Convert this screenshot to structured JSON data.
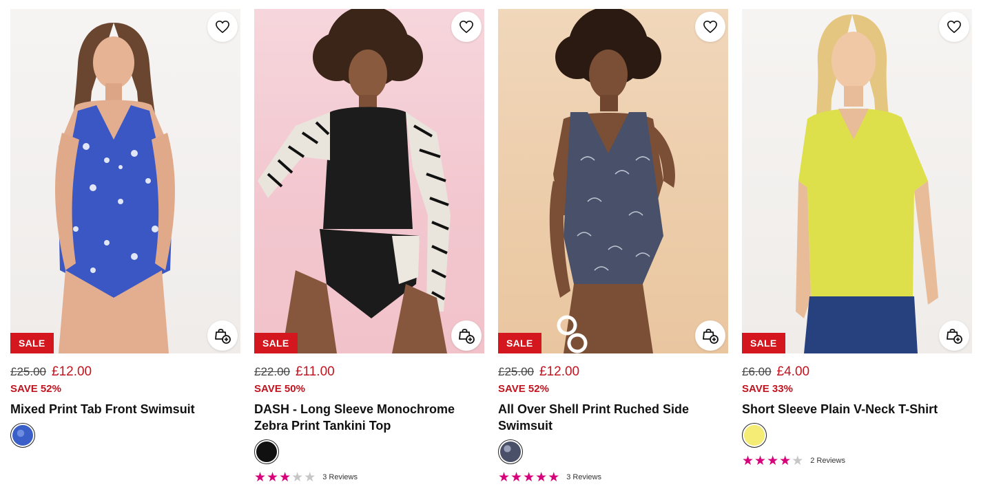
{
  "products": [
    {
      "badge": "SALE",
      "was_price": "£25.00",
      "now_price": "£12.00",
      "save": "SAVE 52%",
      "title": "Mixed Print Tab Front Swimsuit",
      "swatch_color": "#3a5fc8",
      "reviews": null,
      "stars": 0
    },
    {
      "badge": "SALE",
      "was_price": "£22.00",
      "now_price": "£11.00",
      "save": "SAVE 50%",
      "title": "DASH - Long Sleeve Monochrome Zebra Print Tankini Top",
      "swatch_color": "#111111",
      "reviews": "3 Reviews",
      "stars": 3
    },
    {
      "badge": "SALE",
      "was_price": "£25.00",
      "now_price": "£12.00",
      "save": "SAVE 52%",
      "title": "All Over Shell Print Ruched Side Swimsuit",
      "swatch_color": "#4a5068",
      "reviews": "3 Reviews",
      "stars": 5
    },
    {
      "badge": "SALE",
      "was_price": "£6.00",
      "now_price": "£4.00",
      "save": "SAVE 33%",
      "title": "Short Sleeve Plain V-Neck T-Shirt",
      "swatch_color": "#f4ec74",
      "reviews": "2 Reviews",
      "stars": 4
    }
  ],
  "icons": {
    "favourite": "heart-icon",
    "quick_add": "bag-plus-icon",
    "star": "star-icon"
  },
  "colors": {
    "sale_red": "#d4161f",
    "price_red": "#c0141f",
    "star_pink": "#d6007a"
  }
}
